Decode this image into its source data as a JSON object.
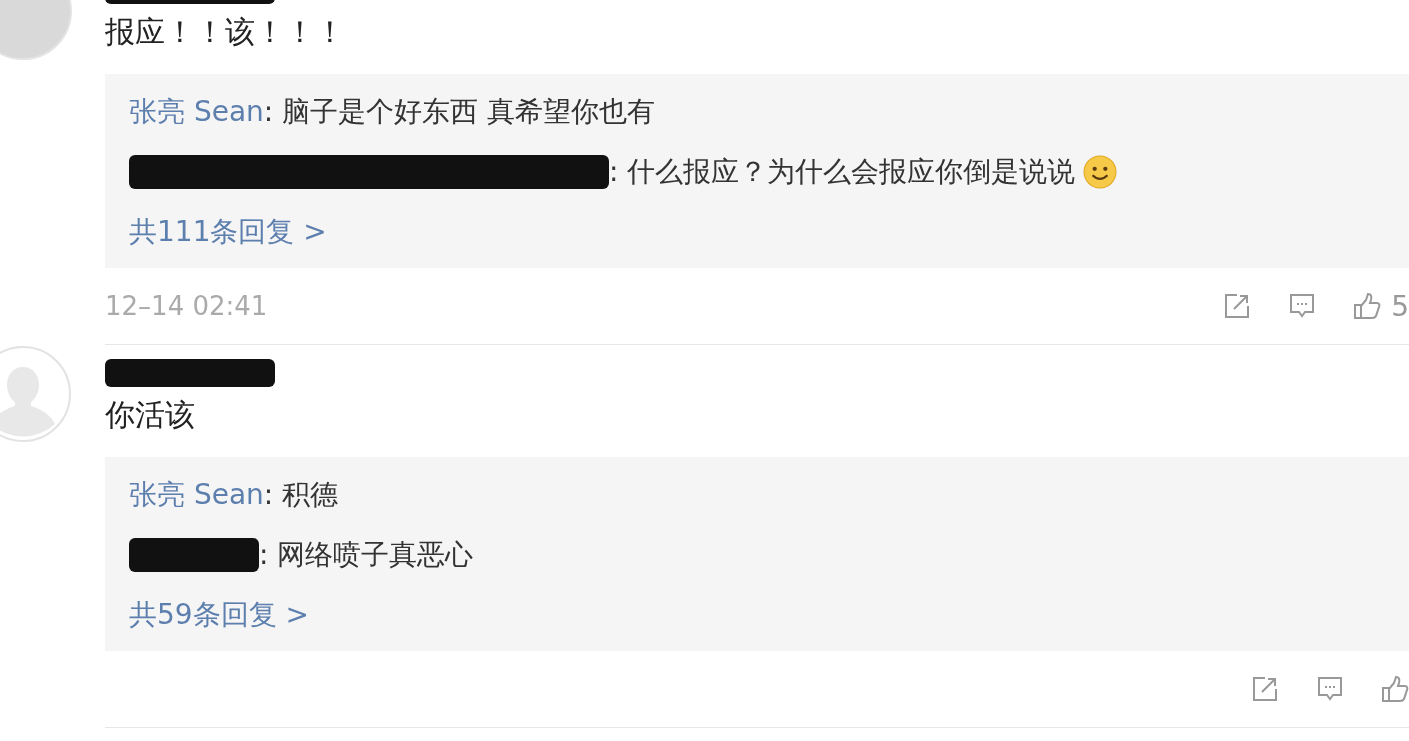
{
  "comments": [
    {
      "kind": "photo-avatar",
      "name_redacted": true,
      "text": "报应！！该！！！",
      "replies": [
        {
          "kind": "named",
          "author": "张亮 Sean",
          "text": ": 脑子是个好东西 真希望你也有",
          "emoji": false
        },
        {
          "kind": "redacted",
          "text": ": 什么报应？为什么会报应你倒是说说",
          "emoji": true
        }
      ],
      "more": "共111条回复 >",
      "time": "12–14 02:41",
      "likes": "5"
    },
    {
      "kind": "default-avatar",
      "name_redacted": true,
      "text": "你活该",
      "replies": [
        {
          "kind": "named",
          "author": "张亮 Sean",
          "text": ": 积德",
          "emoji": false
        },
        {
          "kind": "redacted",
          "text": ": 网络喷子真恶心",
          "emoji": false
        }
      ],
      "more": "共59条回复 >"
    }
  ]
}
